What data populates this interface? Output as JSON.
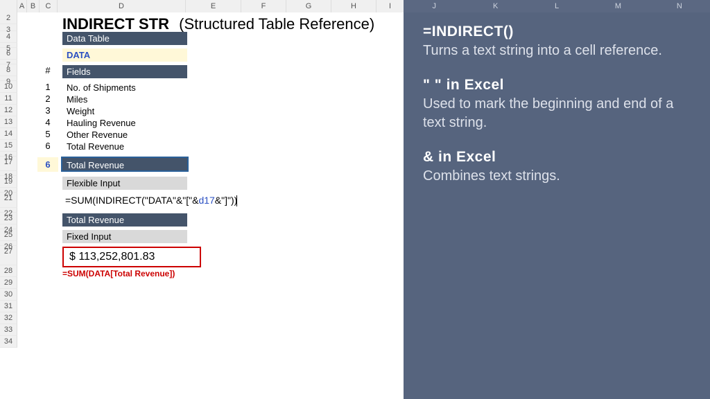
{
  "columns": {
    "left": [
      "A",
      "B",
      "C",
      "D",
      "E",
      "F",
      "G",
      "H",
      "I"
    ],
    "right": [
      "J",
      "K",
      "L",
      "M",
      "N"
    ]
  },
  "rows": [
    "2",
    "3",
    "4",
    "5",
    "6",
    "7",
    "8",
    "9",
    "10",
    "11",
    "12",
    "13",
    "14",
    "15",
    "16",
    "17",
    "18",
    "19",
    "20",
    "21",
    "22",
    "23",
    "24",
    "25",
    "26",
    "27",
    "28",
    "29",
    "30",
    "31",
    "32",
    "33",
    "34"
  ],
  "title": {
    "main": "INDIRECT STR",
    "sub": "(Structured Table Reference)"
  },
  "labels": {
    "data_table": "Data Table",
    "data": "DATA",
    "hash": "#",
    "fields": "Fields",
    "flex_header": "Total Revenue",
    "flex_input": "Flexible Input",
    "fixed_header": "Total Revenue",
    "fixed_input": "Fixed Input",
    "result": "$       113,252,801.83",
    "fixed_formula": "=SUM(DATA[Total Revenue])"
  },
  "formula": {
    "prefix": "=SUM(INDIRECT(\"DATA\"&\"[\"&",
    "ref": "d17",
    "suffix": "&\"]\"))"
  },
  "fields": [
    {
      "n": "1",
      "label": "No. of Shipments"
    },
    {
      "n": "2",
      "label": "Miles"
    },
    {
      "n": "3",
      "label": "Weight"
    },
    {
      "n": "4",
      "label": "Hauling Revenue"
    },
    {
      "n": "5",
      "label": "Other Revenue"
    },
    {
      "n": "6",
      "label": "Total Revenue"
    }
  ],
  "selected_index": "6",
  "info": [
    {
      "title": "=INDIRECT()",
      "body": "Turns a text string into a cell reference."
    },
    {
      "title": "\" \" in Excel",
      "body": "Used to mark the beginning and end of a text string."
    },
    {
      "title": "& in Excel",
      "body": "Combines text strings."
    }
  ]
}
